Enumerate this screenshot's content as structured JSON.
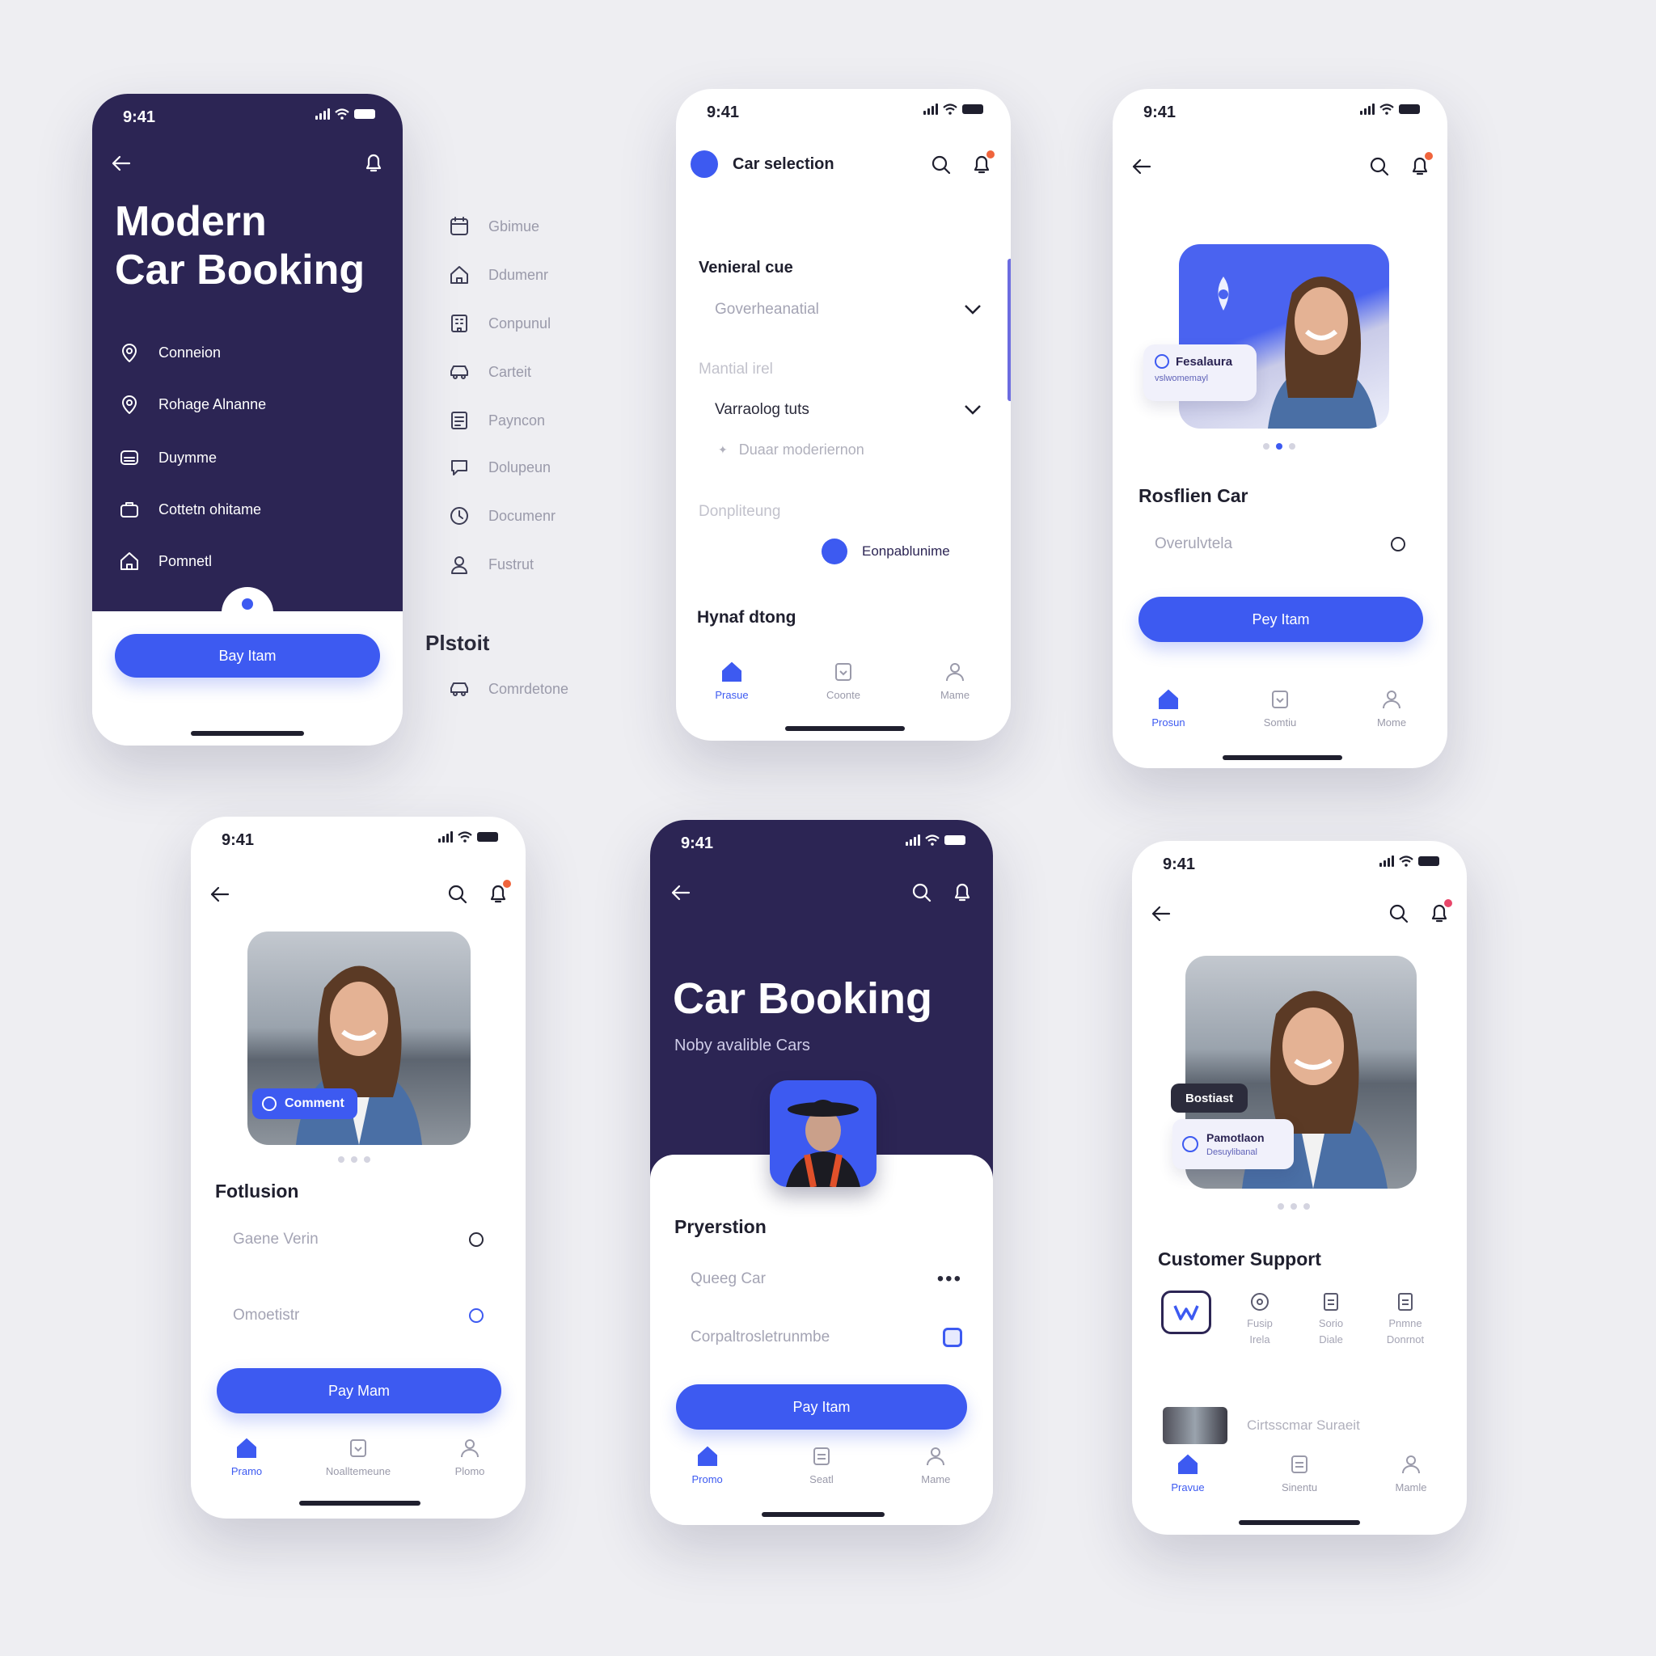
{
  "colors": {
    "accent": "#3d5af1",
    "navy": "#2c2554",
    "background": "#eeeef2",
    "notification": "#f0643c"
  },
  "status_time": "9:41",
  "phone1": {
    "title_line1": "Modern",
    "title_line2": "Car Booking",
    "menu": [
      {
        "icon": "location-pin-icon",
        "label": "Conneion"
      },
      {
        "icon": "location-pin-icon",
        "label": "Rohage Alnanne"
      },
      {
        "icon": "car-seat-icon",
        "label": "Duymme"
      },
      {
        "icon": "briefcase-icon",
        "label": "Cottetn ohitame"
      },
      {
        "icon": "home-icon",
        "label": "Pomnetl"
      }
    ],
    "cta": "Bay Itam"
  },
  "side_menu": {
    "items": [
      {
        "icon": "calendar-icon",
        "label": "Gbimue"
      },
      {
        "icon": "home-icon",
        "label": "Ddumenr"
      },
      {
        "icon": "building-icon",
        "label": "Conpunul"
      },
      {
        "icon": "car-icon",
        "label": "Carteit"
      },
      {
        "icon": "document-icon",
        "label": "Payncon"
      },
      {
        "icon": "chat-icon",
        "label": "Dolupeun"
      },
      {
        "icon": "clock-icon",
        "label": "Documenr"
      },
      {
        "icon": "user-icon",
        "label": "Fustrut"
      }
    ],
    "section_title": "Plstoit",
    "section_item": {
      "icon": "car-icon",
      "label": "Comrdetone"
    }
  },
  "phone2": {
    "header_title": "Car selection",
    "section1_label": "Venieral cue",
    "select1_value": "Goverheanatial",
    "section2_label": "Mantial irel",
    "select2_value": "Varraolog tuts",
    "sub_item": "Duaar moderiernon",
    "section3_label": "Donpliteung",
    "toggle_label": "Eonpablunime",
    "section4_title": "Hynaf dtong",
    "tabs": [
      "Prasue",
      "Coonte",
      "Mame"
    ]
  },
  "phone3": {
    "badge_title": "Fesalaura",
    "badge_sub": "vslwomemayl",
    "title": "Rosflien Car",
    "field": "Overulvtela",
    "cta": "Pey Itam",
    "tabs": [
      "Prosun",
      "Somtiu",
      "Mome"
    ]
  },
  "phone4": {
    "badge": "Comment",
    "title": "Fotlusion",
    "field1": "Gaene Verin",
    "field2": "Omoetistr",
    "cta": "Pay Mam",
    "tabs": [
      "Pramo",
      "Noalltemeune",
      "Plomo"
    ]
  },
  "phone5": {
    "title": "Car Booking",
    "subtitle": "Noby avalible Cars",
    "section_title": "Pryerstion",
    "field1": "Queeg Car",
    "field2": "Corpaltrosletrunmbe",
    "cta": "Pay Itam",
    "tabs": [
      "Promo",
      "Seatl",
      "Mame"
    ]
  },
  "phone6": {
    "badge_dark": "Bostiast",
    "badge_title": "Pamotlaon",
    "badge_sub": "Desuylibanal",
    "title": "Customer Support",
    "support_items": [
      {
        "icon": "logo-w-icon",
        "label": ""
      },
      {
        "icon": "gear-icon",
        "label": "Fusip\nIrela"
      },
      {
        "icon": "document-icon",
        "label": "Sorio\nDiale"
      },
      {
        "icon": "document-icon",
        "label": "Pnmne\nDonrnot"
      }
    ],
    "list_item": "Cirtsscmar Suraeit",
    "tabs": [
      "Pravue",
      "Sinentu",
      "Mamle"
    ]
  }
}
